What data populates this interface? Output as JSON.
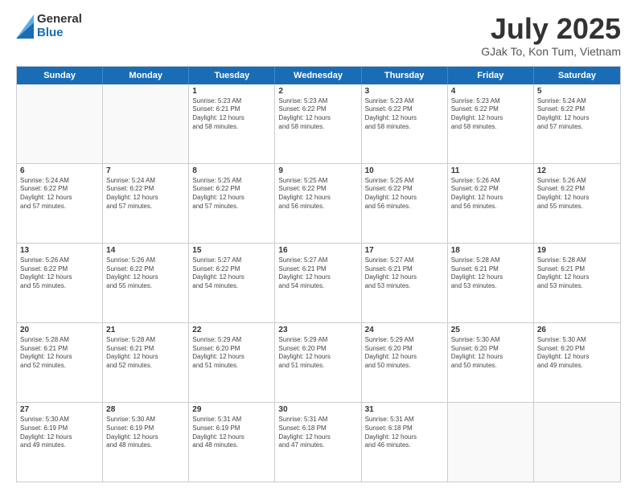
{
  "logo": {
    "general": "General",
    "blue": "Blue"
  },
  "header": {
    "month": "July 2025",
    "location": "GJak To, Kon Tum, Vietnam"
  },
  "weekdays": [
    "Sunday",
    "Monday",
    "Tuesday",
    "Wednesday",
    "Thursday",
    "Friday",
    "Saturday"
  ],
  "weeks": [
    [
      {
        "day": null
      },
      {
        "day": null
      },
      {
        "day": "1",
        "sunrise": "5:23 AM",
        "sunset": "6:21 PM",
        "daylight": "12 hours and 58 minutes."
      },
      {
        "day": "2",
        "sunrise": "5:23 AM",
        "sunset": "6:22 PM",
        "daylight": "12 hours and 58 minutes."
      },
      {
        "day": "3",
        "sunrise": "5:23 AM",
        "sunset": "6:22 PM",
        "daylight": "12 hours and 58 minutes."
      },
      {
        "day": "4",
        "sunrise": "5:23 AM",
        "sunset": "6:22 PM",
        "daylight": "12 hours and 58 minutes."
      },
      {
        "day": "5",
        "sunrise": "5:24 AM",
        "sunset": "6:22 PM",
        "daylight": "12 hours and 57 minutes."
      }
    ],
    [
      {
        "day": "6",
        "sunrise": "5:24 AM",
        "sunset": "6:22 PM",
        "daylight": "12 hours and 57 minutes."
      },
      {
        "day": "7",
        "sunrise": "5:24 AM",
        "sunset": "6:22 PM",
        "daylight": "12 hours and 57 minutes."
      },
      {
        "day": "8",
        "sunrise": "5:25 AM",
        "sunset": "6:22 PM",
        "daylight": "12 hours and 57 minutes."
      },
      {
        "day": "9",
        "sunrise": "5:25 AM",
        "sunset": "6:22 PM",
        "daylight": "12 hours and 56 minutes."
      },
      {
        "day": "10",
        "sunrise": "5:25 AM",
        "sunset": "6:22 PM",
        "daylight": "12 hours and 56 minutes."
      },
      {
        "day": "11",
        "sunrise": "5:26 AM",
        "sunset": "6:22 PM",
        "daylight": "12 hours and 56 minutes."
      },
      {
        "day": "12",
        "sunrise": "5:26 AM",
        "sunset": "6:22 PM",
        "daylight": "12 hours and 55 minutes."
      }
    ],
    [
      {
        "day": "13",
        "sunrise": "5:26 AM",
        "sunset": "6:22 PM",
        "daylight": "12 hours and 55 minutes."
      },
      {
        "day": "14",
        "sunrise": "5:26 AM",
        "sunset": "6:22 PM",
        "daylight": "12 hours and 55 minutes."
      },
      {
        "day": "15",
        "sunrise": "5:27 AM",
        "sunset": "6:22 PM",
        "daylight": "12 hours and 54 minutes."
      },
      {
        "day": "16",
        "sunrise": "5:27 AM",
        "sunset": "6:21 PM",
        "daylight": "12 hours and 54 minutes."
      },
      {
        "day": "17",
        "sunrise": "5:27 AM",
        "sunset": "6:21 PM",
        "daylight": "12 hours and 53 minutes."
      },
      {
        "day": "18",
        "sunrise": "5:28 AM",
        "sunset": "6:21 PM",
        "daylight": "12 hours and 53 minutes."
      },
      {
        "day": "19",
        "sunrise": "5:28 AM",
        "sunset": "6:21 PM",
        "daylight": "12 hours and 53 minutes."
      }
    ],
    [
      {
        "day": "20",
        "sunrise": "5:28 AM",
        "sunset": "6:21 PM",
        "daylight": "12 hours and 52 minutes."
      },
      {
        "day": "21",
        "sunrise": "5:28 AM",
        "sunset": "6:21 PM",
        "daylight": "12 hours and 52 minutes."
      },
      {
        "day": "22",
        "sunrise": "5:29 AM",
        "sunset": "6:20 PM",
        "daylight": "12 hours and 51 minutes."
      },
      {
        "day": "23",
        "sunrise": "5:29 AM",
        "sunset": "6:20 PM",
        "daylight": "12 hours and 51 minutes."
      },
      {
        "day": "24",
        "sunrise": "5:29 AM",
        "sunset": "6:20 PM",
        "daylight": "12 hours and 50 minutes."
      },
      {
        "day": "25",
        "sunrise": "5:30 AM",
        "sunset": "6:20 PM",
        "daylight": "12 hours and 50 minutes."
      },
      {
        "day": "26",
        "sunrise": "5:30 AM",
        "sunset": "6:20 PM",
        "daylight": "12 hours and 49 minutes."
      }
    ],
    [
      {
        "day": "27",
        "sunrise": "5:30 AM",
        "sunset": "6:19 PM",
        "daylight": "12 hours and 49 minutes."
      },
      {
        "day": "28",
        "sunrise": "5:30 AM",
        "sunset": "6:19 PM",
        "daylight": "12 hours and 48 minutes."
      },
      {
        "day": "29",
        "sunrise": "5:31 AM",
        "sunset": "6:19 PM",
        "daylight": "12 hours and 48 minutes."
      },
      {
        "day": "30",
        "sunrise": "5:31 AM",
        "sunset": "6:18 PM",
        "daylight": "12 hours and 47 minutes."
      },
      {
        "day": "31",
        "sunrise": "5:31 AM",
        "sunset": "6:18 PM",
        "daylight": "12 hours and 46 minutes."
      },
      {
        "day": null
      },
      {
        "day": null
      }
    ]
  ],
  "labels": {
    "sunrise": "Sunrise:",
    "sunset": "Sunset:",
    "daylight": "Daylight:"
  }
}
